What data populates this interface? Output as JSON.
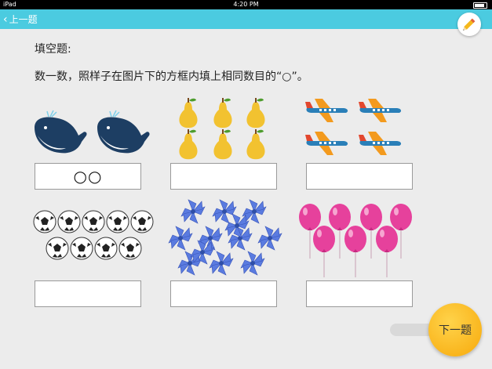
{
  "status_bar": {
    "device": "iPad",
    "time": "4:20 PM"
  },
  "nav": {
    "back_label": "上一题"
  },
  "question": {
    "title": "填空题:",
    "instruction": "数一数，照样子在图片下的方框内填上相同数目的“○”。"
  },
  "items": [
    {
      "name": "whales",
      "count": 2,
      "answer": "○○"
    },
    {
      "name": "pears",
      "count": 6,
      "answer": ""
    },
    {
      "name": "airplanes",
      "count": 4,
      "answer": ""
    },
    {
      "name": "soccer-balls",
      "count": 9,
      "answer": ""
    },
    {
      "name": "flowers",
      "count": 12,
      "answer": ""
    },
    {
      "name": "balloons",
      "count": 7,
      "answer": ""
    }
  ],
  "next_button": {
    "label": "下一题"
  },
  "colors": {
    "nav": "#4bcbe0",
    "next_button": "#f7a90b",
    "balloon": "#e6419c",
    "whale": "#1d3e63",
    "pear": "#f2c230",
    "flower": "#5a7be0"
  }
}
